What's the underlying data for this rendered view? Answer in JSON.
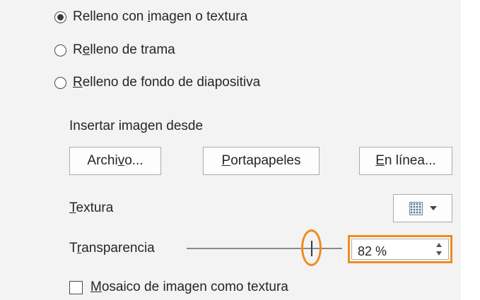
{
  "fill_options": [
    {
      "pre": "Relleno con ",
      "key": "i",
      "post": "magen o textura",
      "checked": true
    },
    {
      "pre": "R",
      "key": "e",
      "post": "lleno de trama",
      "checked": false
    },
    {
      "pre": "",
      "key": "R",
      "post": "elleno de fondo de diapositiva",
      "checked": false
    }
  ],
  "insert_image": {
    "label": "Insertar imagen desde",
    "buttons": [
      {
        "pre": "Archi",
        "key": "v",
        "post": "o..."
      },
      {
        "pre": "",
        "key": "P",
        "post": "ortapapeles"
      },
      {
        "pre": "",
        "key": "E",
        "post": "n línea..."
      }
    ]
  },
  "texture": {
    "pre": "",
    "key": "T",
    "post": "extura",
    "icon": "texture-swatch-icon"
  },
  "transparency": {
    "pre": "T",
    "key": "r",
    "post": "ansparencia",
    "value": 82,
    "display": "82 %",
    "highlight_color": "#f28a1e"
  },
  "tile": {
    "pre": "",
    "key": "M",
    "post": "osaico de imagen como textura",
    "checked": false
  }
}
